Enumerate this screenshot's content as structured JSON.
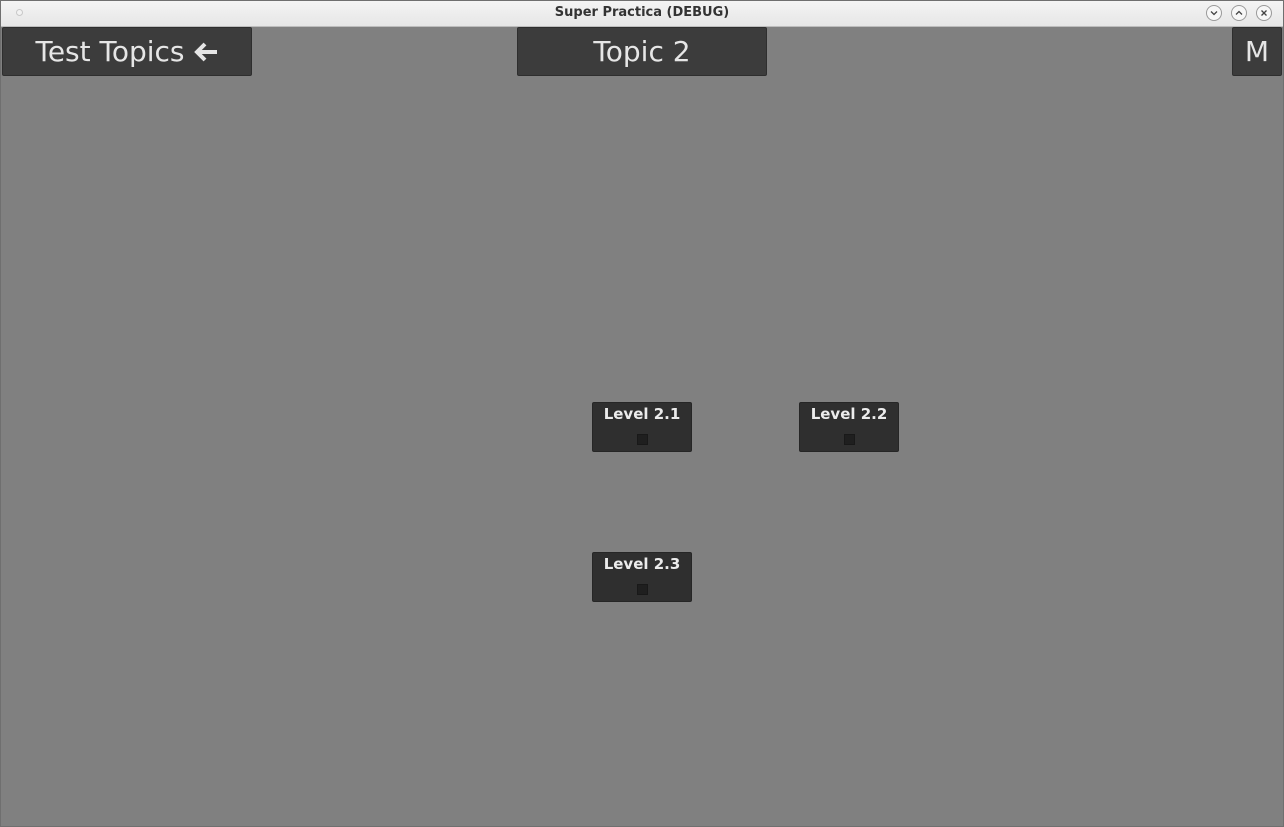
{
  "window": {
    "title": "Super Practica (DEBUG)"
  },
  "header": {
    "back_label": "Test Topics",
    "back_icon": "arrow-left-icon",
    "topic_title": "Topic 2",
    "menu_label": "M"
  },
  "levels": [
    {
      "label": "Level 2.1",
      "completed": false
    },
    {
      "label": "Level 2.2",
      "completed": false
    },
    {
      "label": "Level 2.3",
      "completed": false
    }
  ],
  "colors": {
    "background": "#808080",
    "button": "#3c3c3c",
    "level_tile": "#2f2f2f",
    "text": "#e6e6e6"
  }
}
